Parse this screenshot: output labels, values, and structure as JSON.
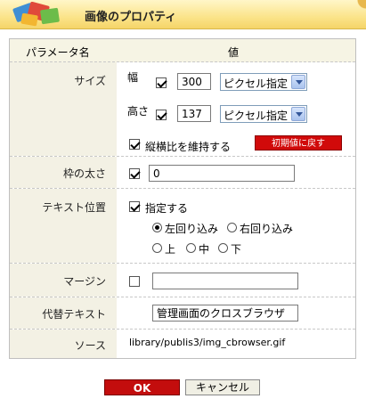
{
  "header": {
    "title": "画像のプロパティ"
  },
  "table": {
    "param_header": "パラメータ名",
    "value_header": "値"
  },
  "size": {
    "label": "サイズ",
    "width_label": "幅",
    "width_value": "300",
    "width_unit": "ピクセル指定",
    "height_label": "高さ",
    "height_value": "137",
    "height_unit": "ピクセル指定",
    "keep_ratio_label": "縦横比を維持する",
    "reset_label": "初期値に戻す"
  },
  "border": {
    "label": "枠の太さ",
    "value": "0"
  },
  "text_position": {
    "label": "テキスト位置",
    "specify_label": "指定する",
    "wrap_left": "左回り込み",
    "wrap_right": "右回り込み",
    "top": "上",
    "middle": "中",
    "bottom": "下"
  },
  "margin": {
    "label": "マージン",
    "value": ""
  },
  "alt_text": {
    "label": "代替テキスト",
    "value": "管理画面のクロスブラウザ"
  },
  "source": {
    "label": "ソース",
    "value": "library/publis3/img_cbrowser.gif"
  },
  "buttons": {
    "ok": "OK",
    "cancel": "キャンセル"
  },
  "colors": {
    "accent_red": "#c30d0d",
    "label_bg": "#f3f1e4",
    "header_bg": "#fbe48a"
  }
}
